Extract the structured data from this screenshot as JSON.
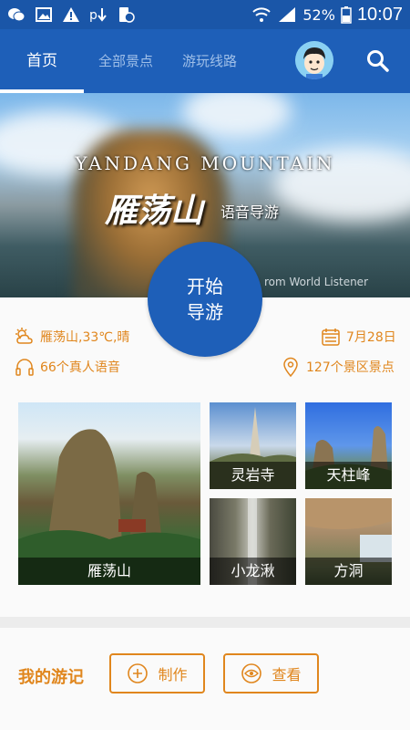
{
  "status_bar": {
    "battery": "52%",
    "time": "10:07"
  },
  "tabs": [
    {
      "label": "首页",
      "active": true
    },
    {
      "label": "全部景点",
      "active": false
    },
    {
      "label": "游玩线路",
      "active": false
    }
  ],
  "hero": {
    "title_en": "YANDANG  MOUNTAIN",
    "title_cn": "雁荡山",
    "subtitle": "语音导游",
    "credit": "rom World Listener"
  },
  "start_button": {
    "line1": "开始",
    "line2": "导游"
  },
  "info": {
    "weather": "雁荡山,33℃,晴",
    "date": "7月28日",
    "voices": "66个真人语音",
    "spots": "127个景区景点"
  },
  "tiles": [
    {
      "label": "雁荡山"
    },
    {
      "label": "灵岩寺"
    },
    {
      "label": "天柱峰"
    },
    {
      "label": "小龙湫"
    },
    {
      "label": "方洞"
    }
  ],
  "diary": {
    "title": "我的游记",
    "make_label": "制作",
    "view_label": "查看"
  },
  "colors": {
    "primary": "#1e5fb8",
    "accent": "#e0861d"
  }
}
